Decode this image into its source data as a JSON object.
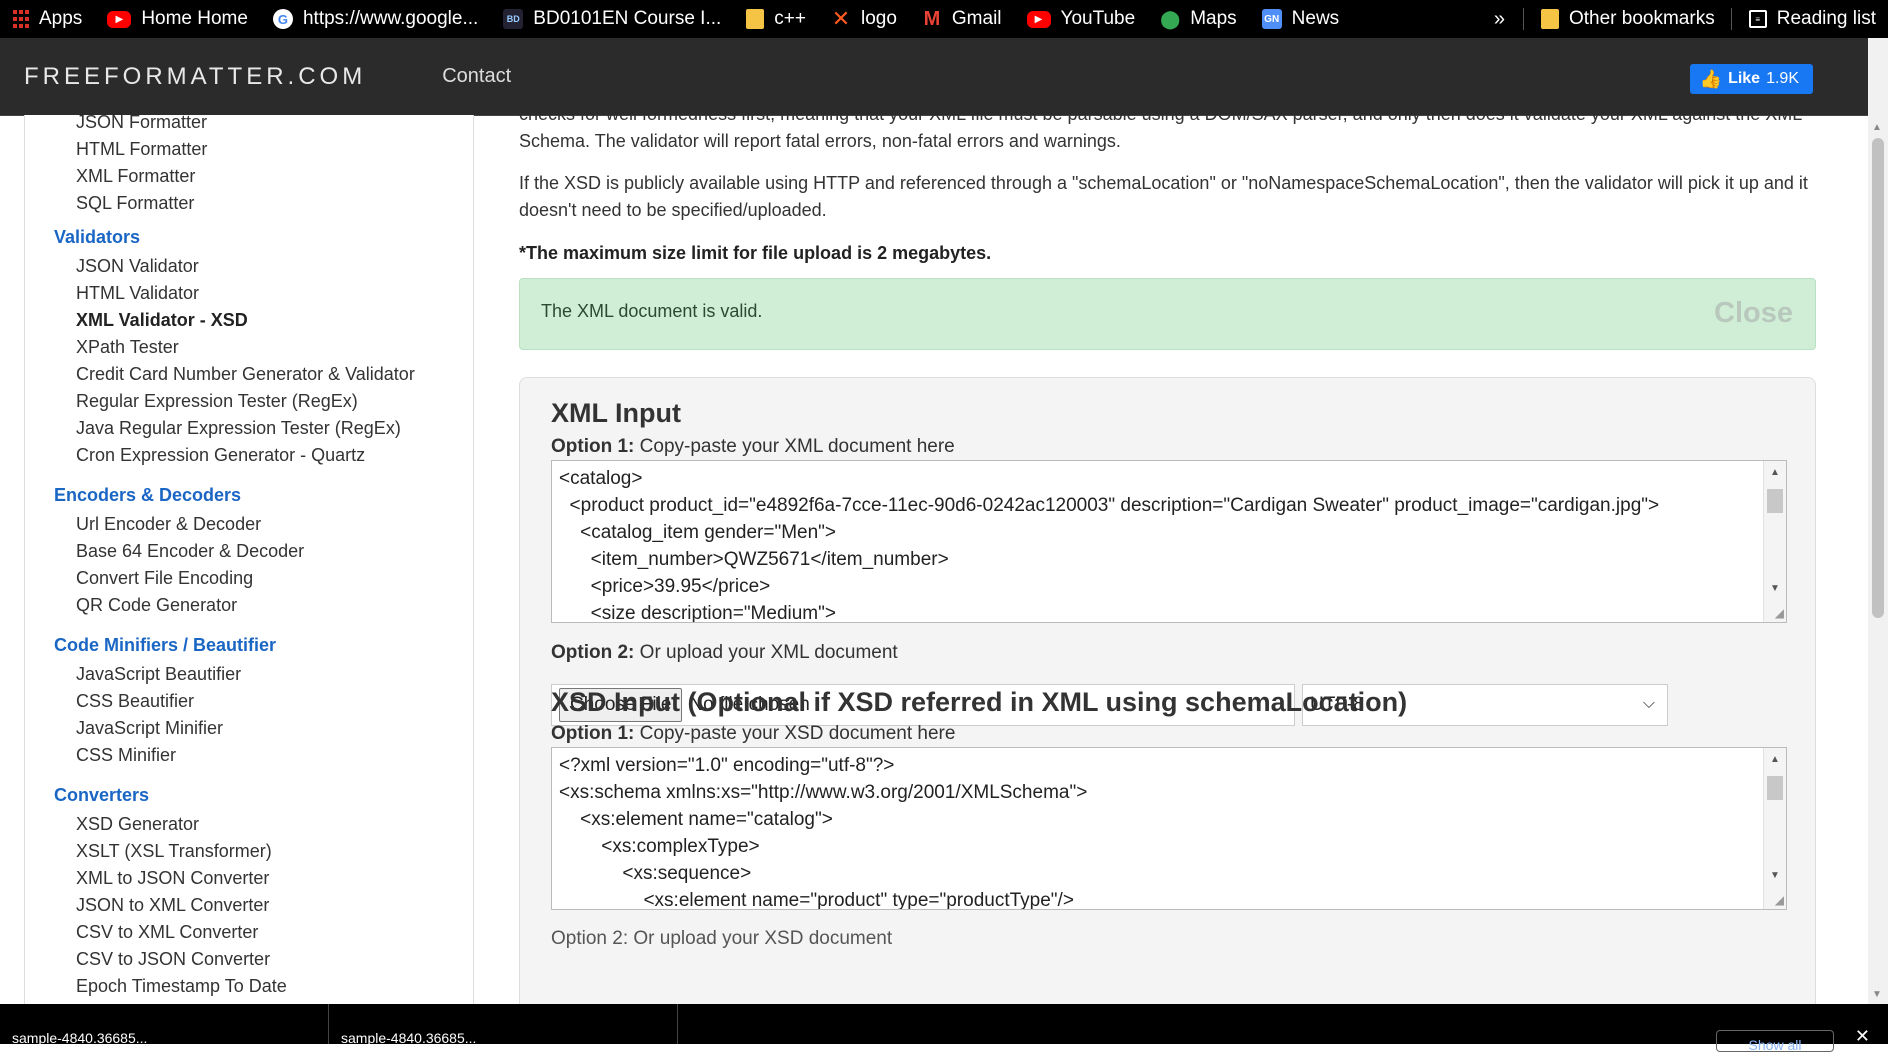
{
  "bookmarks": [
    {
      "label": "Apps",
      "icon": "apps-grid-icon"
    },
    {
      "label": "Home Home",
      "icon": "youtube-icon"
    },
    {
      "label": "https://www.google...",
      "icon": "google-icon"
    },
    {
      "label": "BD0101EN Course I...",
      "icon": "course-icon"
    },
    {
      "label": "c++",
      "icon": "folder-icon"
    },
    {
      "label": "logo",
      "icon": "x-logo-icon"
    },
    {
      "label": "Gmail",
      "icon": "gmail-icon"
    },
    {
      "label": "YouTube",
      "icon": "youtube-icon"
    },
    {
      "label": "Maps",
      "icon": "maps-icon"
    },
    {
      "label": "News",
      "icon": "news-icon"
    }
  ],
  "bookmarks_more": "»",
  "other_bookmarks": "Other bookmarks",
  "reading_list": "Reading list",
  "header": {
    "logo": "FREEFORMATTER.COM",
    "nav": "Contact",
    "fb_like": "Like",
    "fb_count": "1.9K"
  },
  "sidebar": {
    "formatters": [
      "JSON Formatter",
      "HTML Formatter",
      "XML Formatter",
      "SQL Formatter"
    ],
    "sections": [
      {
        "title": "Validators",
        "items": [
          "JSON Validator",
          "HTML Validator",
          "XML Validator - XSD",
          "XPath Tester",
          "Credit Card Number Generator & Validator",
          "Regular Expression Tester (RegEx)",
          "Java Regular Expression Tester (RegEx)",
          "Cron Expression Generator - Quartz"
        ]
      },
      {
        "title": "Encoders & Decoders",
        "items": [
          "Url Encoder & Decoder",
          "Base 64 Encoder & Decoder",
          "Convert File Encoding",
          "QR Code Generator"
        ]
      },
      {
        "title": "Code Minifiers / Beautifier",
        "items": [
          "JavaScript Beautifier",
          "CSS Beautifier",
          "JavaScript Minifier",
          "CSS Minifier"
        ]
      },
      {
        "title": "Converters",
        "items": [
          "XSD Generator",
          "XSLT (XSL Transformer)",
          "XML to JSON Converter",
          "JSON to XML Converter",
          "CSV to XML Converter",
          "CSV to JSON Converter",
          "Epoch Timestamp To Date"
        ]
      }
    ],
    "active": "XML Validator - XSD"
  },
  "main": {
    "p1": "checks for well formedness first, meaning that your XML file must be parsable using a DOM/SAX parser, and only then does it validate your XML against the XML Schema. The validator will report fatal errors, non-fatal errors and warnings.",
    "p2": "If the XSD is publicly available using HTTP and referenced through a \"schemaLocation\" or \"noNamespaceSchemaLocation\", then the validator will pick it up and it doesn't need to be specified/uploaded.",
    "p3": "*The maximum size limit for file upload is 2 megabytes.",
    "alert": "The XML document is valid.",
    "alert_close": "Close",
    "xml_heading": "XML Input",
    "xml_opt1_label": "Option 1:",
    "xml_opt1_text": " Copy-paste your XML document here",
    "xml_lines": [
      "<catalog>",
      "  <product product_id=\"e4892f6a-7cce-11ec-90d6-0242ac120003\" description=\"Cardigan Sweater\" product_image=\"cardigan.jpg\">",
      "    <catalog_item gender=\"Men\">",
      "      <item_number>QWZ5671</item_number>",
      "      <price>39.95</price>",
      "      <size description=\"Medium\">"
    ],
    "xml_opt2_label": "Option 2:",
    "xml_opt2_text": " Or upload your XML document",
    "choose_file": "Choose File",
    "no_file": "No file chosen",
    "encoding": "UTF-8",
    "xsd_heading": "XSD Input (Optional if XSD referred in XML using schemaLocation)",
    "xsd_opt1_label": "Option 1:",
    "xsd_opt1_text": " Copy-paste your XSD document here",
    "xsd_lines": [
      "<?xml version=\"1.0\" encoding=\"utf-8\"?>",
      "<xs:schema xmlns:xs=\"http://www.w3.org/2001/XMLSchema\">",
      "    <xs:element name=\"catalog\">",
      "        <xs:complexType>",
      "            <xs:sequence>",
      "                <xs:element name=\"product\" type=\"productType\"/>"
    ],
    "xsd_opt2_partial": "Option 2: Or upload your XSD document"
  },
  "downloads": {
    "item1": "sample-4840.36685...",
    "item2": "sample-4840.36685...",
    "show_all": "Show all",
    "close": "✕"
  }
}
